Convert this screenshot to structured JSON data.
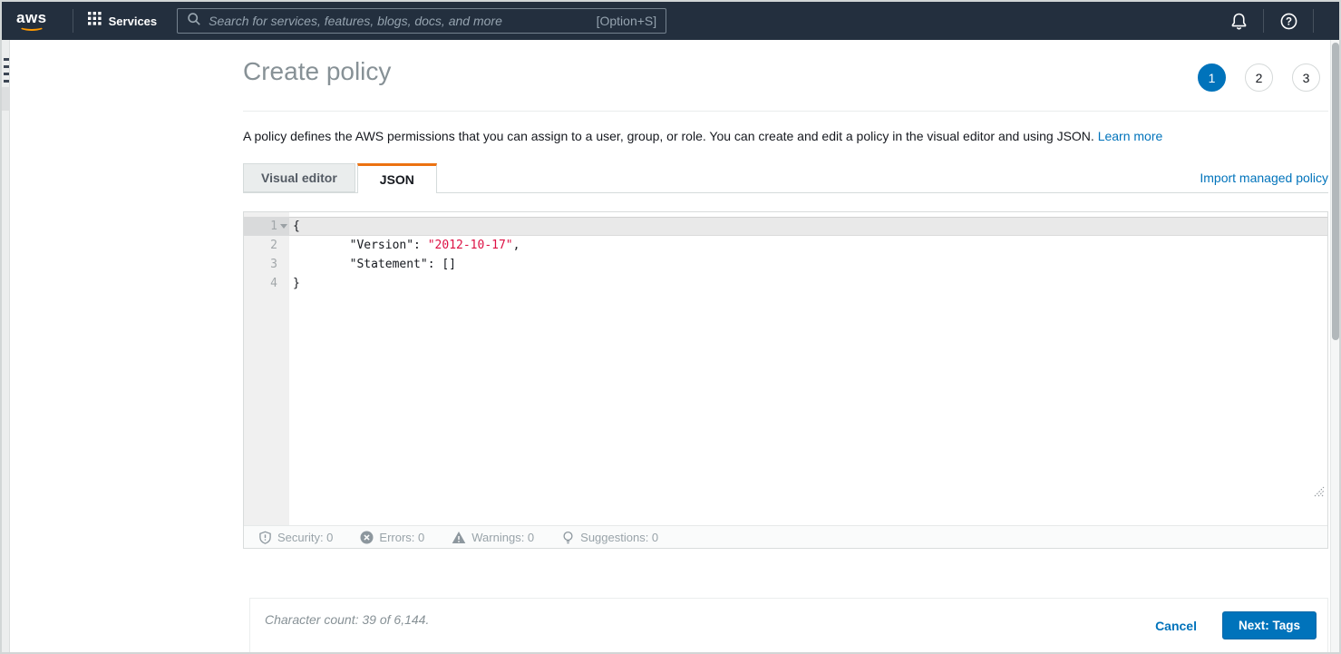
{
  "topbar": {
    "logo": "aws",
    "services_label": "Services",
    "search_placeholder": "Search for services, features, blogs, docs, and more",
    "search_shortcut": "[Option+S]"
  },
  "header": {
    "title": "Create policy",
    "steps": [
      "1",
      "2",
      "3"
    ],
    "active_step": "1"
  },
  "intro": {
    "text": "A policy defines the AWS permissions that you can assign to a user, group, or role. You can create and edit a policy in the visual editor and using JSON. ",
    "link_label": "Learn more"
  },
  "tabs": {
    "visual_editor": "Visual editor",
    "json": "JSON",
    "import_link": "Import managed policy"
  },
  "editor": {
    "lines": [
      {
        "num": "1",
        "code": "{"
      },
      {
        "num": "2",
        "pre": "        \"Version\": ",
        "string": "\"2012-10-17\"",
        "post": ","
      },
      {
        "num": "3",
        "code": "        \"Statement\": []"
      },
      {
        "num": "4",
        "code": "}"
      }
    ],
    "status": {
      "security": "Security: 0",
      "errors": "Errors: 0",
      "warnings": "Warnings: 0",
      "suggestions": "Suggestions: 0"
    }
  },
  "footer": {
    "character_count": "Character count: 39 of 6,144.",
    "cancel_label": "Cancel",
    "next_label": "Next: Tags"
  },
  "colors": {
    "topbar_navy": "#232f3e",
    "accent_blue": "#0073bb",
    "tab_orange": "#ec7211",
    "string_red": "#dd1144",
    "logo_orange": "#ff9900"
  }
}
